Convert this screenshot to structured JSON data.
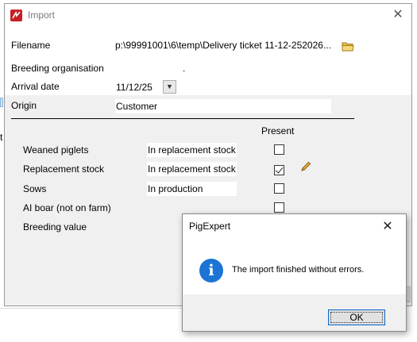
{
  "background": {
    "fragment_t": "t"
  },
  "import_window": {
    "title": "Import",
    "filename_label": "Filename",
    "filename_value": "p:\\99991001\\6\\temp\\Delivery ticket 11-12-252026...",
    "breeding_org_label": "Breeding organisation",
    "breeding_org_value": "",
    "breeding_org_suffix": ".",
    "arrival_date_label": "Arrival date",
    "arrival_date_value": "11/12/25",
    "origin_label": "Origin",
    "origin_value": "Customer",
    "present_header": "Present",
    "rows": [
      {
        "label": "Weaned piglets",
        "value": "In replacement stock",
        "present": false
      },
      {
        "label": "Replacement stock",
        "value": "In replacement stock",
        "present": true
      },
      {
        "label": "Sows",
        "value": "In production",
        "present": false
      },
      {
        "label": "AI boar (not on farm)",
        "value": "",
        "present": false
      },
      {
        "label": "Breeding value",
        "value": "",
        "present": null
      }
    ]
  },
  "dialog": {
    "title": "PigExpert",
    "message": "The import finished without errors.",
    "ok_label": "OK"
  },
  "icons": {
    "app": "pigexpert-app-icon",
    "folder": "folder-icon",
    "edit": "pencil-icon",
    "info": "information-icon"
  },
  "colors": {
    "info_icon": "#1c74d4",
    "app_icon": "#c62026",
    "folder": "#e8c14a"
  }
}
